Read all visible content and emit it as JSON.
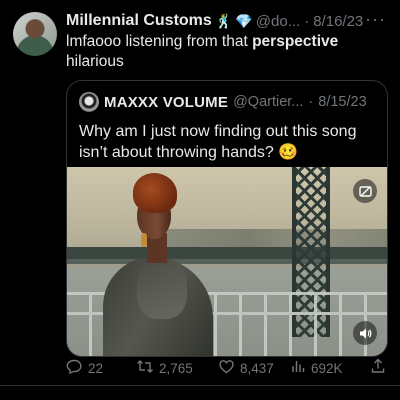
{
  "tweet": {
    "display_name": "Millennial Customs",
    "badges": [
      "dancer-emoji",
      "gem-emoji"
    ],
    "handle": "@do...",
    "dot": "·",
    "date": "8/16/23",
    "more": "···",
    "text_before": "lmfaooo listening from that ",
    "text_bold": "perspective",
    "text_after": " hilarious"
  },
  "quote": {
    "display_name": "MAXXX VOLUME",
    "handle": "@Qartier...",
    "dot": "·",
    "date": "8/15/23",
    "text": "Why am I just now finding out this song isn’t about throwing hands? 🥴",
    "media": {
      "gif_icon": "gif-toggle-icon",
      "sound_icon": "speaker-icon"
    }
  },
  "actions": {
    "replies": "22",
    "retweets": "2,765",
    "likes": "8,437",
    "views": "692K"
  },
  "colors": {
    "background": "#000000",
    "text_primary": "#e7e9ea",
    "text_secondary": "#71767b",
    "border": "#2f3336"
  }
}
